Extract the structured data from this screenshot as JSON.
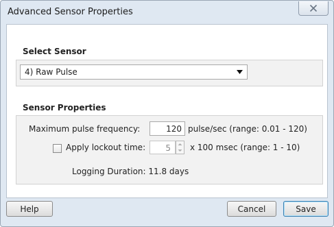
{
  "window": {
    "title": "Advanced Sensor Properties",
    "close_icon": "close-icon"
  },
  "select_sensor": {
    "heading": "Select Sensor",
    "selected": "4) Raw Pulse",
    "arrow_icon": "dropdown-arrow-icon"
  },
  "sensor_properties": {
    "heading": "Sensor Properties",
    "max_freq_label": "Maximum pulse frequency:",
    "max_freq_value": "120",
    "max_freq_unit": "pulse/sec (range: 0.01 - 120)",
    "lockout_label": "Apply lockout time:",
    "lockout_checked": false,
    "lockout_value": "5",
    "lockout_unit": "x 100 msec (range: 1 - 10)",
    "logging_duration": "Logging Duration: 11.8 days"
  },
  "buttons": {
    "help": "Help",
    "cancel": "Cancel",
    "save": "Save"
  },
  "colors": {
    "frame": "#dfe8f2",
    "group_bg": "#f2f2f2",
    "disabled_text": "#8a8a8a",
    "default_button_border": "#3c7fb1"
  }
}
